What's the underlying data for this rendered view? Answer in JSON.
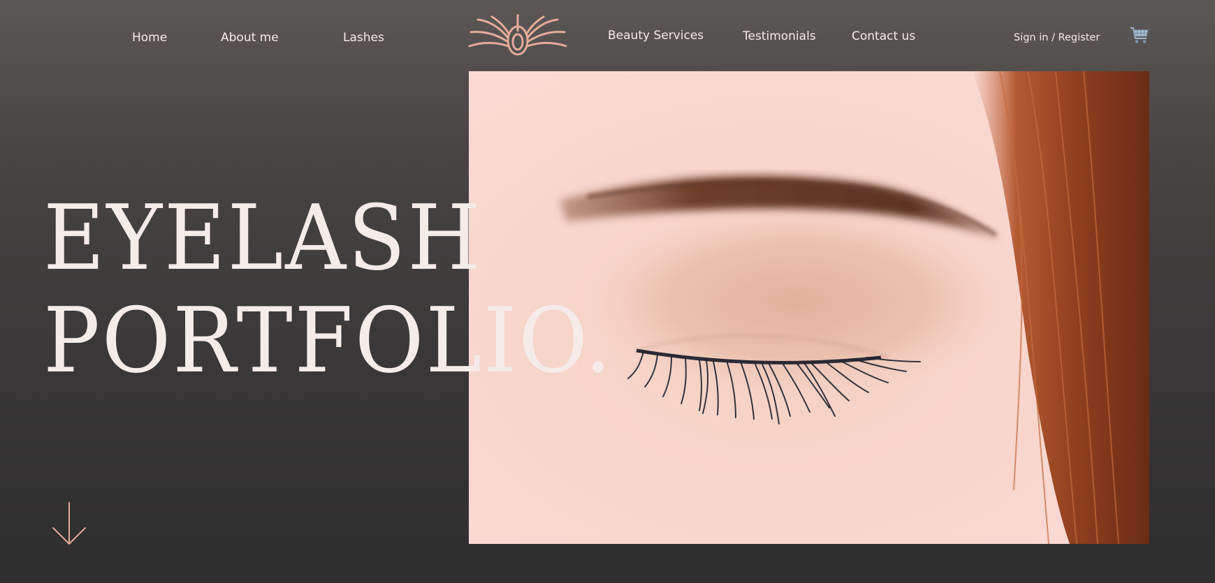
{
  "nav": {
    "home": "Home",
    "about": "About me",
    "lashes": "Lashes",
    "beauty_services": "Beauty Services",
    "testimonials": "Testimonials",
    "contact": "Contact us",
    "sign_in": "Sign in / Register"
  },
  "hero": {
    "line_1": "EYELASH",
    "line_2": "PORTFOLIO."
  },
  "icons": {
    "logo": "eyelash-logo",
    "cart": "shopping-cart-icon",
    "scroll": "arrow-down-icon"
  },
  "colors": {
    "accent": "#e7ab9a",
    "text": "#f5ecea",
    "background": "#3a3838"
  }
}
